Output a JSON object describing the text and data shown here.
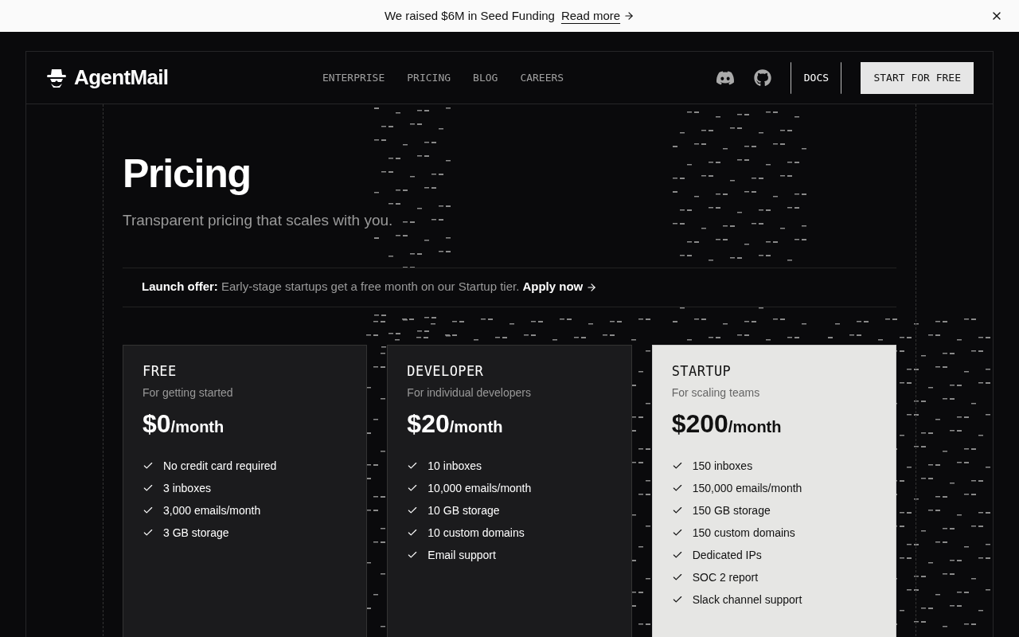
{
  "banner": {
    "text": "We raised $6M in Seed Funding",
    "link": "Read more"
  },
  "nav": {
    "logo": "AgentMail",
    "links": [
      "ENTERPRISE",
      "PRICING",
      "BLOG",
      "CAREERS"
    ],
    "docs": "DOCS",
    "cta": "START FOR FREE"
  },
  "hero": {
    "title": "Pricing",
    "subtitle": "Transparent pricing that scales with you."
  },
  "offer": {
    "label": "Launch offer:",
    "text": "Early-stage startups get a free month on our Startup tier.",
    "link": "Apply now"
  },
  "plans": [
    {
      "name": "FREE",
      "tagline": "For getting started",
      "price": "$0",
      "period": "/month",
      "highlighted": false,
      "features": [
        "No credit card required",
        "3 inboxes",
        "3,000 emails/month",
        "3 GB storage"
      ]
    },
    {
      "name": "DEVELOPER",
      "tagline": "For individual developers",
      "price": "$20",
      "period": "/month",
      "highlighted": false,
      "features": [
        "10 inboxes",
        "10,000 emails/month",
        "10 GB storage",
        "10 custom domains",
        "Email support"
      ]
    },
    {
      "name": "STARTUP",
      "tagline": "For scaling teams",
      "price": "$200",
      "period": "/month",
      "highlighted": true,
      "features": [
        "150 inboxes",
        "150,000 emails/month",
        "150 GB storage",
        "150 custom domains",
        "Dedicated IPs",
        "SOC 2 report",
        "Slack channel support"
      ]
    }
  ]
}
